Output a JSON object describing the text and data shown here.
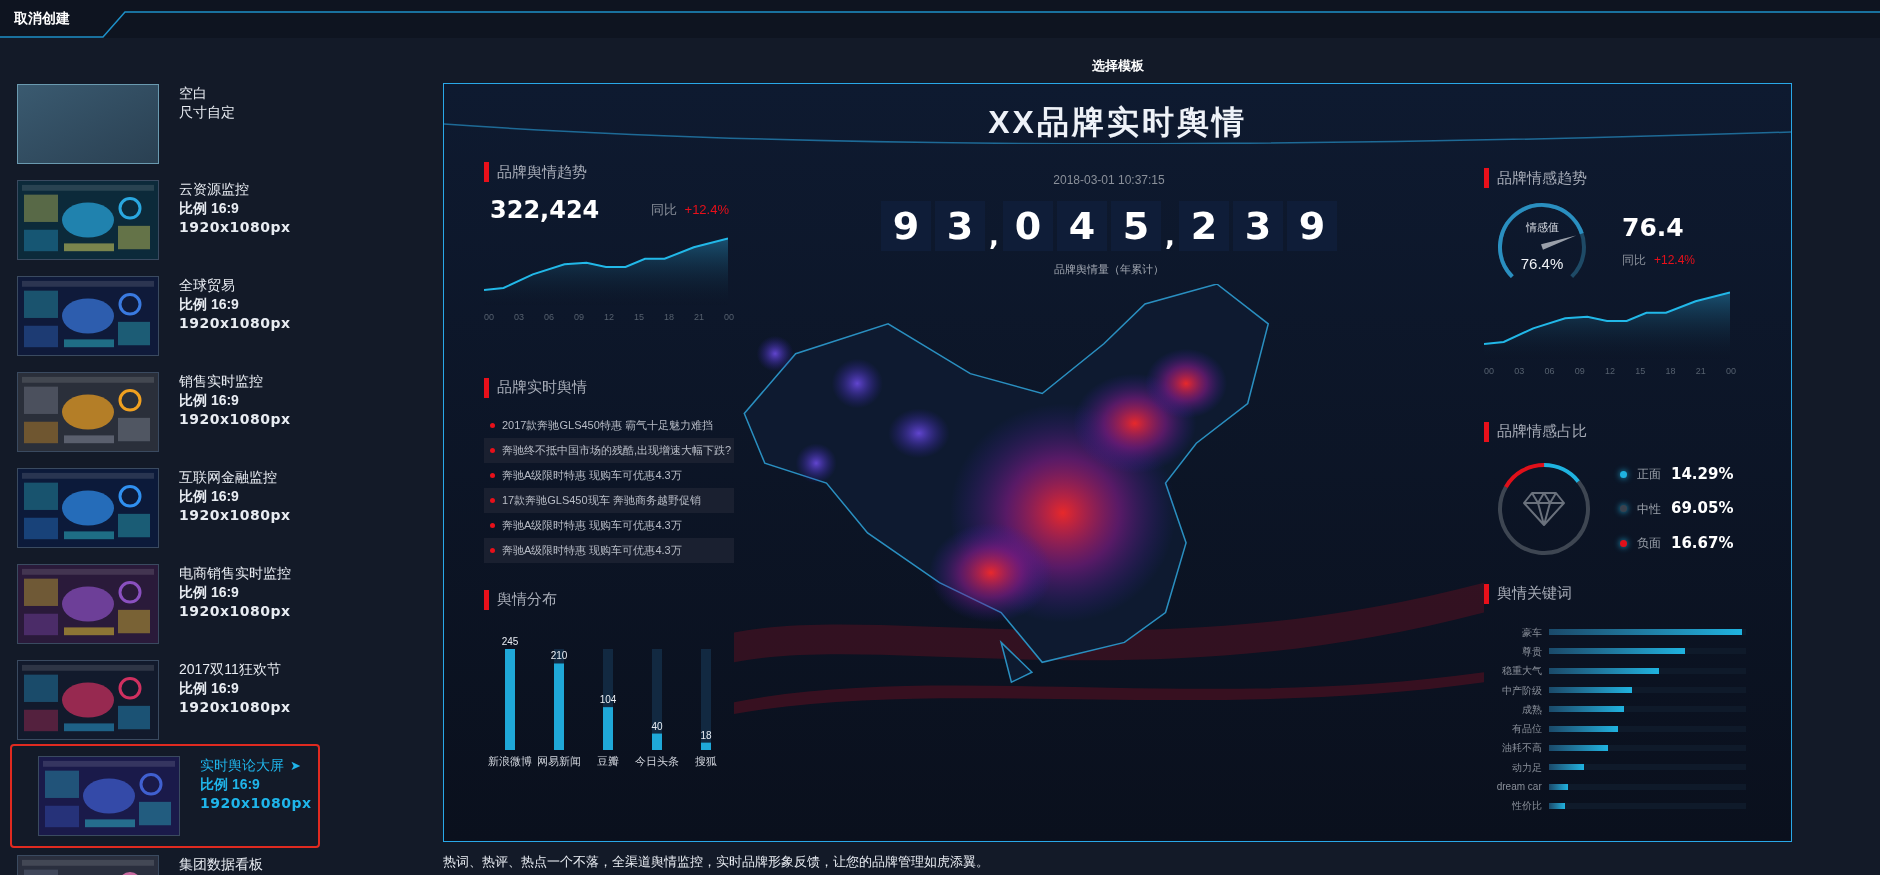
{
  "header": {
    "cancel_label": "取消创建"
  },
  "templates": [
    {
      "kind": "blank",
      "name": "空白",
      "subtitle": "尺寸自定",
      "selected": false
    },
    {
      "kind": "template",
      "name": "云资源监控",
      "ratio": "比例 16:9",
      "size": "1920x1080px",
      "selected": false
    },
    {
      "kind": "template",
      "name": "全球贸易",
      "ratio": "比例 16:9",
      "size": "1920x1080px",
      "selected": false
    },
    {
      "kind": "template",
      "name": "销售实时监控",
      "ratio": "比例 16:9",
      "size": "1920x1080px",
      "selected": false
    },
    {
      "kind": "template",
      "name": "互联网金融监控",
      "ratio": "比例 16:9",
      "size": "1920x1080px",
      "selected": false
    },
    {
      "kind": "template",
      "name": "电商销售实时监控",
      "ratio": "比例 16:9",
      "size": "1920x1080px",
      "selected": false
    },
    {
      "kind": "template",
      "name": "2017双11狂欢节",
      "ratio": "比例 16:9",
      "size": "1920x1080px",
      "selected": false
    },
    {
      "kind": "template",
      "name": "实时舆论大屏",
      "arrow": "➤",
      "ratio": "比例 16:9",
      "size": "1920x1080px",
      "selected": true
    },
    {
      "kind": "template",
      "name": "集团数据看板",
      "selected": false
    }
  ],
  "preview": {
    "heading": "选择模板",
    "title": "XX品牌实时舆情",
    "brand_trend": {
      "title": "品牌舆情趋势",
      "value": "322,424",
      "compare_label": "同比",
      "change": "+12.4%",
      "xtick_labels": [
        "00",
        "03",
        "06",
        "09",
        "12",
        "15",
        "18",
        "21",
        "00"
      ]
    },
    "news": {
      "title": "品牌实时舆情",
      "items": [
        "2017款奔驰GLS450特惠 霸气十足魅力难挡",
        "奔驰终不抵中国市场的残酷,出现增速大幅下跌?",
        "奔驰A级限时特惠 现购车可优惠4.3万",
        "17款奔驰GLS450现车 奔驰商务越野促销",
        "奔驰A级限时特惠 现购车可优惠4.3万",
        "奔驰A级限时特惠 现购车可优惠4.3万"
      ]
    },
    "distribution": {
      "chart_data": {
        "type": "bar",
        "title": "舆情分布",
        "categories": [
          "新浪微博",
          "网易新闻",
          "豆瓣",
          "今日头条",
          "搜狐"
        ],
        "values": [
          245,
          210,
          104,
          40,
          18
        ],
        "ylim": [
          0,
          245
        ],
        "data_labels": true
      }
    },
    "datetime": "2018-03-01 10:37:15",
    "counter": [
      {
        "kind": "digit",
        "char": "9"
      },
      {
        "kind": "digit",
        "char": "3"
      },
      {
        "kind": "separator",
        "char": ","
      },
      {
        "kind": "digit",
        "char": "0"
      },
      {
        "kind": "digit",
        "char": "4"
      },
      {
        "kind": "digit",
        "char": "5"
      },
      {
        "kind": "separator",
        "char": ","
      },
      {
        "kind": "digit",
        "char": "2"
      },
      {
        "kind": "digit",
        "char": "3"
      },
      {
        "kind": "digit",
        "char": "9"
      }
    ],
    "counter_label": "品牌舆情量（年累计）",
    "sentiment_trend": {
      "title": "品牌情感趋势",
      "gauge": {
        "label": "情感值",
        "reading": "76.4%",
        "level": 0.764
      },
      "value": "76.4",
      "compare_label": "同比",
      "change": "+12.4%",
      "xtick_labels": [
        "00",
        "03",
        "06",
        "09",
        "12",
        "15",
        "18",
        "21",
        "00"
      ]
    },
    "sentiment_share": {
      "title": "品牌情感占比",
      "items": [
        {
          "label": "正面",
          "value": "14.29%",
          "color": "#1fb3e0",
          "level": 0.1429
        },
        {
          "label": "中性",
          "value": "69.05%",
          "color": "#3a424e",
          "level": 0.6905
        },
        {
          "label": "负面",
          "value": "16.67%",
          "color": "#e0101a",
          "level": 0.1667
        }
      ]
    },
    "keywords": {
      "title": "舆情关键词",
      "items": [
        {
          "label": "豪车",
          "level": 0.98
        },
        {
          "label": "尊贵",
          "level": 0.69
        },
        {
          "label": "稳重大气",
          "level": 0.56
        },
        {
          "label": "中产阶级",
          "level": 0.42
        },
        {
          "label": "成熟",
          "level": 0.38
        },
        {
          "label": "有品位",
          "level": 0.35
        },
        {
          "label": "油耗不高",
          "level": 0.3
        },
        {
          "label": "动力足",
          "level": 0.18
        },
        {
          "label": "dream car",
          "level": 0.1
        },
        {
          "label": "性价比",
          "level": 0.08
        }
      ]
    }
  },
  "caption": "热词、热评、热点一个不落，全渠道舆情监控，实时品牌形象反馈，让您的品牌管理如虎添翼。"
}
